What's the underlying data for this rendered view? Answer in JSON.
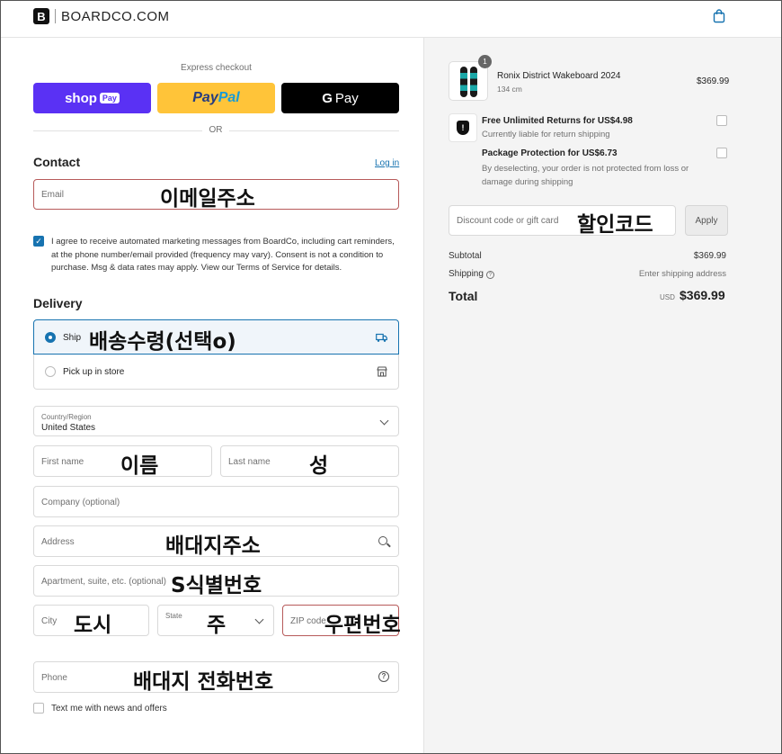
{
  "header": {
    "brand": "BOARDCO.COM",
    "logo_letter": "B"
  },
  "express": {
    "title": "Express checkout",
    "shop_label": "shop",
    "shop_badge": "Pay",
    "paypal_a": "Pay",
    "paypal_b": "Pal",
    "gpay_g": "G",
    "gpay_label": "Pay",
    "or": "OR"
  },
  "contact": {
    "heading": "Contact",
    "login": "Log in",
    "email_placeholder": "Email",
    "email_annotation": "이메일주소",
    "consent": "I agree to receive automated marketing messages from BoardCo, including cart reminders, at the phone number/email provided (frequency may vary). Consent is not a condition to purchase. Msg & data rates may apply. View our Terms of Service for details.",
    "consent_checked": true
  },
  "delivery": {
    "heading": "Delivery",
    "ship_label": "Ship",
    "ship_annotation": "배송수령(선택o)",
    "pickup_label": "Pick up in store",
    "country_label": "Country/Region",
    "country_value": "United States",
    "first_name": "First name",
    "first_name_annotation": "이름",
    "last_name": "Last name",
    "last_name_annotation": "성",
    "company": "Company (optional)",
    "address": "Address",
    "address_annotation": "배대지주소",
    "apartment": "Apartment, suite, etc. (optional)",
    "apartment_annotation": "S식별번호",
    "city": "City",
    "city_annotation": "도시",
    "state": "State",
    "state_annotation": "주",
    "zip": "ZIP code",
    "zip_annotation": "우편번호",
    "phone": "Phone",
    "phone_annotation": "배대지 전화번호",
    "textme": "Text me with news and offers"
  },
  "cart": {
    "item_qty": "1",
    "item_name": "Ronix District Wakeboard 2024",
    "item_size": "134 cm",
    "item_price": "$369.99",
    "returns_title": "Free Unlimited Returns for US$4.98",
    "returns_sub": "Currently liable for return shipping",
    "package_title": "Package Protection for US$6.73",
    "package_sub": "By deselecting, your order is not protected from loss or damage during shipping",
    "discount_placeholder": "Discount code or gift card",
    "discount_annotation": "할인코드",
    "apply": "Apply",
    "subtotal_label": "Subtotal",
    "subtotal_value": "$369.99",
    "shipping_label": "Shipping",
    "shipping_value": "Enter shipping address",
    "total_label": "Total",
    "total_currency": "USD",
    "total_value": "$369.99"
  },
  "colors": {
    "accent": "#1773b0",
    "shop_pay": "#5a31f4",
    "paypal": "#ffc439",
    "error_border": "#b75a5a"
  }
}
